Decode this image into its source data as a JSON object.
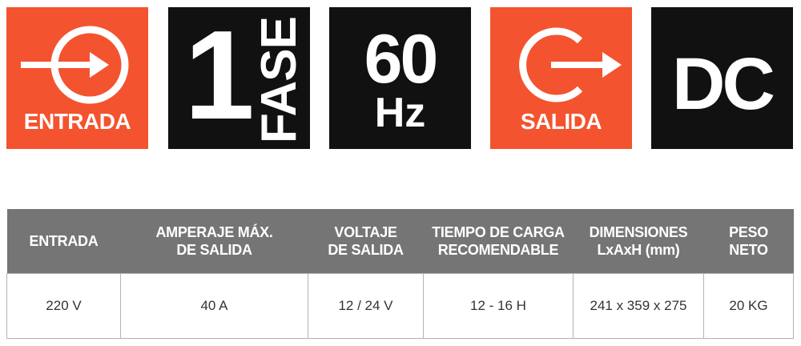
{
  "tiles": [
    {
      "label": "ENTRADA",
      "icon": "input-arrow-icon",
      "color": "#f4532f"
    },
    {
      "number": "1",
      "text": "FASE",
      "color": "#111111"
    },
    {
      "number": "60",
      "unit": "Hz",
      "color": "#111111"
    },
    {
      "label": "SALIDA",
      "icon": "output-arrow-icon",
      "color": "#f4532f"
    },
    {
      "text": "DC",
      "color": "#111111"
    }
  ],
  "table": {
    "header_color": "#757575",
    "headers": [
      {
        "line1": "ENTRADA",
        "line2": ""
      },
      {
        "line1": "AMPERAJE MÁX.",
        "line2": "DE SALIDA"
      },
      {
        "line1": "VOLTAJE",
        "line2": "DE SALIDA"
      },
      {
        "line1": "TIEMPO DE CARGA",
        "line2": "RECOMENDABLE"
      },
      {
        "line1": "DIMENSIONES",
        "line2": "LxAxH (mm)"
      },
      {
        "line1": "PESO",
        "line2": "NETO"
      }
    ],
    "row": [
      "220 V",
      "40 A",
      "12 / 24 V",
      "12 - 16 H",
      "241 x 359 x 275",
      "20 KG"
    ]
  }
}
